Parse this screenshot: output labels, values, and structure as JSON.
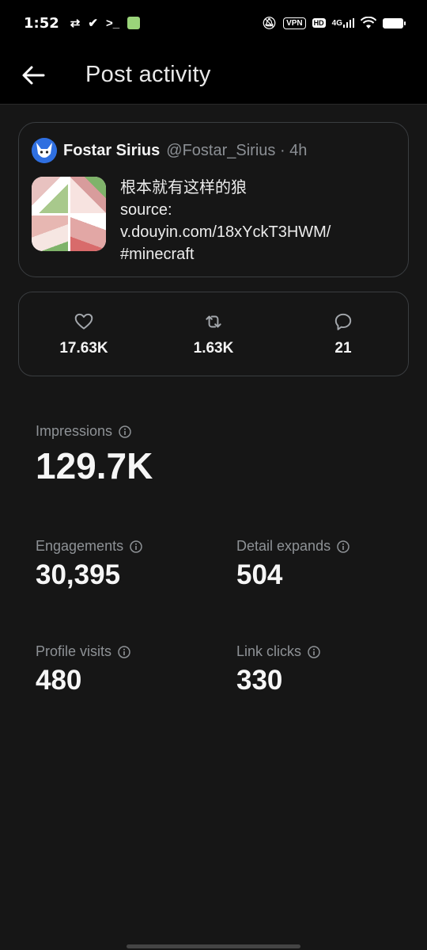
{
  "status_bar": {
    "time": "1:52",
    "vpn": "VPN",
    "hd": "HD",
    "network": "4G"
  },
  "app_bar": {
    "title": "Post activity"
  },
  "post": {
    "author_name": "Fostar Sirius",
    "author_handle": "@Fostar_Sirius · 4h",
    "text_lines": [
      "根本就有这样的狼",
      "source:",
      "v.douyin.com/18xYckT3HWM/",
      "#minecraft"
    ]
  },
  "engagement_summary": {
    "likes": "17.63K",
    "reposts": "1.63K",
    "replies": "21"
  },
  "metrics": {
    "impressions": {
      "label": "Impressions",
      "value": "129.7K"
    },
    "engagements": {
      "label": "Engagements",
      "value": "30,395"
    },
    "detail_expands": {
      "label": "Detail expands",
      "value": "504"
    },
    "profile_visits": {
      "label": "Profile visits",
      "value": "480"
    },
    "link_clicks": {
      "label": "Link clicks",
      "value": "330"
    }
  },
  "colors": {
    "background": "#161616",
    "header": "#000000",
    "border": "#3a3d40",
    "muted_text": "#8e9296"
  }
}
